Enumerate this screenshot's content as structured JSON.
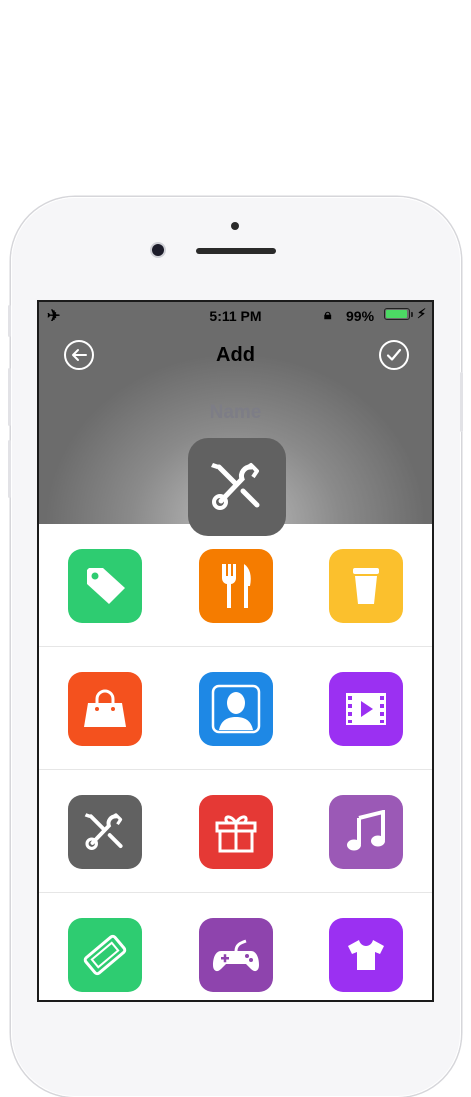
{
  "status_bar": {
    "time": "5:11 PM",
    "battery": "99%",
    "battery_level": 0.99
  },
  "nav": {
    "title": "Add",
    "back_icon": "arrow-left-circle-icon",
    "done_icon": "checkmark-circle-icon"
  },
  "name_field": {
    "placeholder": "Name"
  },
  "selected_icon": {
    "icon": "tools-icon",
    "color": "#616161"
  },
  "icon_grid": [
    [
      {
        "icon": "tag-icon",
        "color": "#2ecc71"
      },
      {
        "icon": "fork-knife-icon",
        "color": "#f57c00"
      },
      {
        "icon": "cup-icon",
        "color": "#fbc02d"
      }
    ],
    [
      {
        "icon": "shopping-bag-icon",
        "color": "#f4511e"
      },
      {
        "icon": "person-icon",
        "color": "#1e88e5"
      },
      {
        "icon": "film-icon",
        "color": "#9b30f2"
      }
    ],
    [
      {
        "icon": "tools-icon",
        "color": "#616161"
      },
      {
        "icon": "gift-icon",
        "color": "#e53935"
      },
      {
        "icon": "music-note-icon",
        "color": "#9b59b6"
      }
    ],
    [
      {
        "icon": "ticket-icon",
        "color": "#2ecc71"
      },
      {
        "icon": "gamepad-icon",
        "color": "#8e44ad"
      },
      {
        "icon": "tshirt-icon",
        "color": "#9b30f2"
      }
    ]
  ]
}
